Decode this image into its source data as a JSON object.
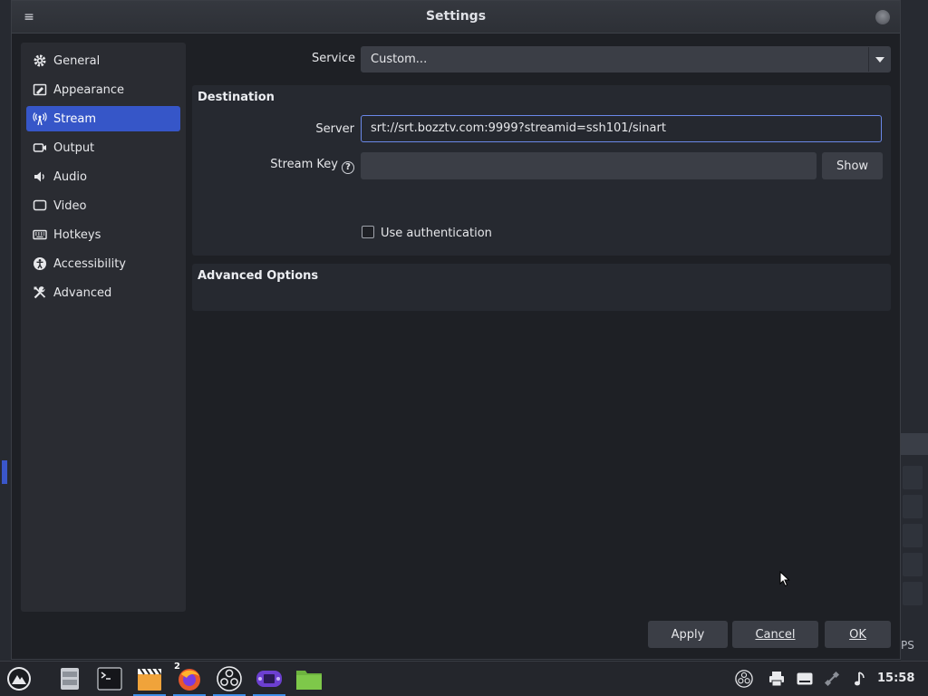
{
  "window": {
    "title": "Settings"
  },
  "sidebar": {
    "items": [
      {
        "label": "General",
        "icon": "gear-icon"
      },
      {
        "label": "Appearance",
        "icon": "appearance-icon"
      },
      {
        "label": "Stream",
        "icon": "antenna-icon"
      },
      {
        "label": "Output",
        "icon": "output-icon"
      },
      {
        "label": "Audio",
        "icon": "speaker-icon"
      },
      {
        "label": "Video",
        "icon": "monitor-icon"
      },
      {
        "label": "Hotkeys",
        "icon": "keyboard-icon"
      },
      {
        "label": "Accessibility",
        "icon": "accessibility-icon"
      },
      {
        "label": "Advanced",
        "icon": "tools-icon"
      }
    ],
    "active": "Stream"
  },
  "stream": {
    "service_label": "Service",
    "service_value": "Custom...",
    "destination_title": "Destination",
    "server_label": "Server",
    "server_value": "srt://srt.bozztv.com:9999?streamid=ssh101/sinart",
    "stream_key_label": "Stream Key",
    "stream_key_value": "",
    "show_label": "Show",
    "use_auth_label": "Use authentication",
    "use_auth_checked": false,
    "advanced_title": "Advanced Options"
  },
  "buttons": {
    "apply": "Apply",
    "cancel": "Cancel",
    "ok": "OK"
  },
  "background": {
    "fps_fragment": "PS"
  },
  "taskbar": {
    "apps": [
      "launcher-icon",
      "file-manager-icon",
      "terminal-icon",
      "video-editor-icon",
      "firefox-icon",
      "obs-icon",
      "emulator-icon",
      "files-icon"
    ],
    "firefox_badge": "2",
    "clock": "15:58"
  },
  "colors": {
    "accent": "#3656c8",
    "focus": "#6a88e8"
  }
}
